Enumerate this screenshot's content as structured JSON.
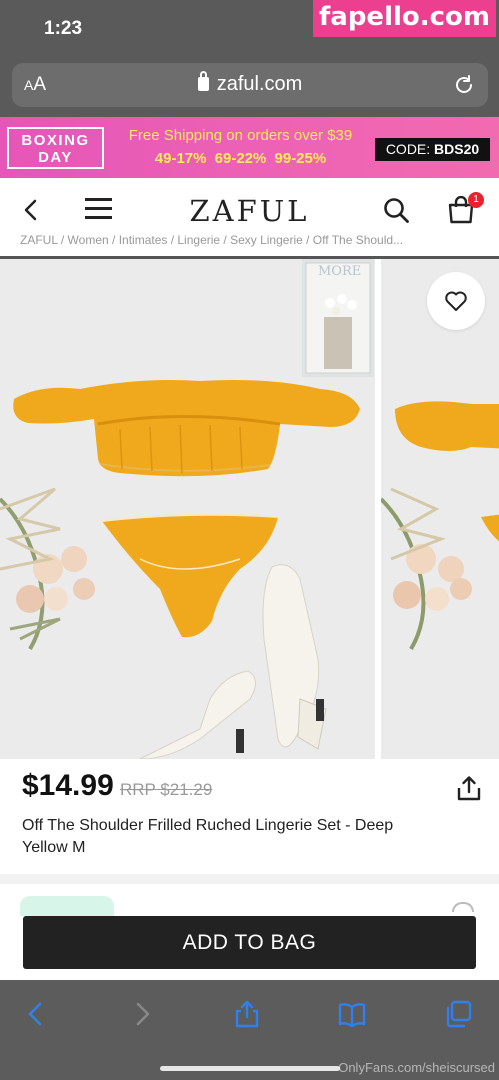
{
  "status": {
    "time": "1:23"
  },
  "watermark": {
    "top": "fapello.com",
    "bottom": "OnlyFans.com/sheiscursed"
  },
  "url_bar": {
    "aa_label_big": "A",
    "aa_label_small": "A",
    "domain": "zaful.com"
  },
  "promo": {
    "boxing_line1": "BOXING",
    "boxing_line2": "DAY",
    "shipping": "Free Shipping on orders over $39",
    "discounts": "49-17%  69-22%  99-25%",
    "code_label": "CODE:",
    "code_value": "BDS20"
  },
  "nav": {
    "logo": "ZAFUL",
    "cart_count": "1"
  },
  "breadcrumb": "ZAFUL / Women / Intimates / Lingerie / Sexy Lingerie / Off The Should...",
  "product": {
    "price": "$14.99",
    "rrp": "RRP $21.29",
    "title": "Off The Shoulder Frilled Ruched Lingerie Set - Deep Yellow M",
    "add_to_bag": "ADD TO BAG",
    "photo_prop_text": "MORE"
  },
  "colors": {
    "promo_pink": "#ee63b4",
    "promo_yellow": "#ffea5a",
    "garment_yellow": "#f0a91c",
    "badge_red": "#e8232e",
    "safari_blue": "#2f80ed"
  }
}
